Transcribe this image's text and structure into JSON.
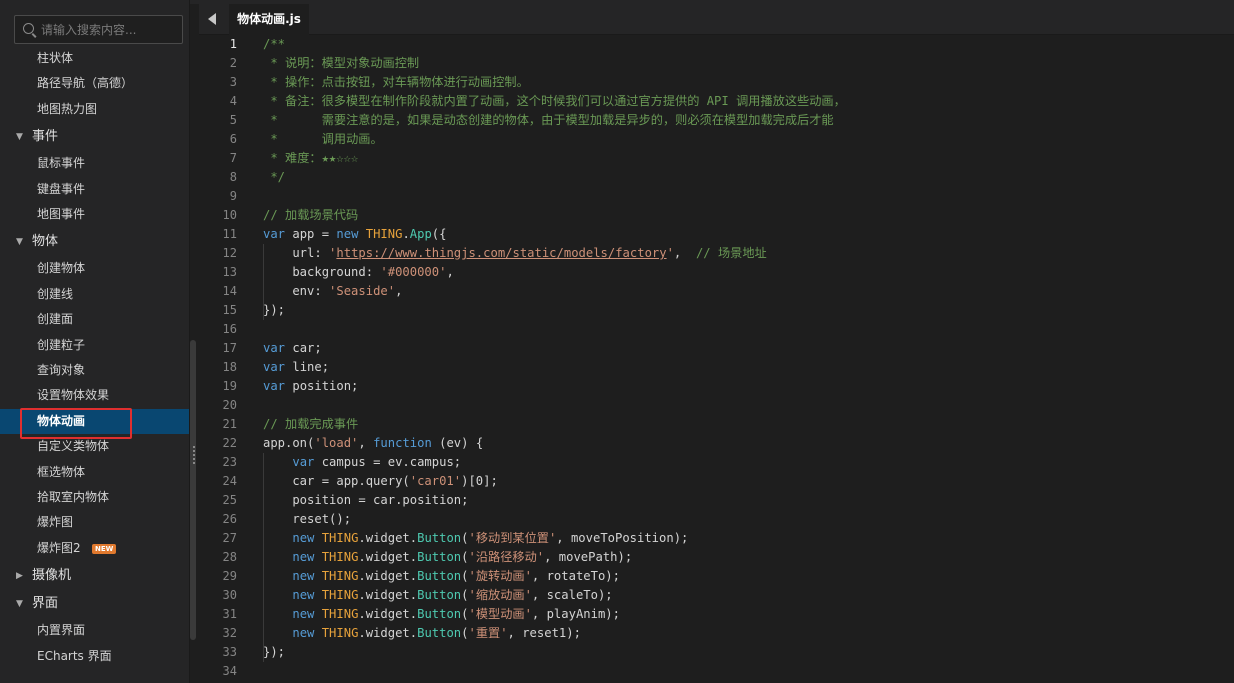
{
  "sidebar": {
    "search_placeholder": "请输入搜索内容...",
    "items_top": [
      {
        "label": "柱状体"
      },
      {
        "label": "路径导航（高德）"
      },
      {
        "label": "地图热力图"
      }
    ],
    "groups": [
      {
        "label": "事件",
        "expanded": true,
        "items": [
          "鼠标事件",
          "键盘事件",
          "地图事件"
        ]
      },
      {
        "label": "物体",
        "expanded": true,
        "items": [
          "创建物体",
          "创建线",
          "创建面",
          "创建粒子",
          "查询对象",
          "设置物体效果",
          "物体动画",
          "自定义类物体",
          "框选物体",
          "拾取室内物体",
          "爆炸图",
          "爆炸图2"
        ]
      },
      {
        "label": "摄像机",
        "expanded": false,
        "items": []
      },
      {
        "label": "界面",
        "expanded": true,
        "items": [
          "内置界面",
          "ECharts 界面"
        ]
      }
    ],
    "selected_item": "物体动画",
    "badge_text": "NEW"
  },
  "tabbar": {
    "active_tab": "物体动画.js"
  },
  "editor": {
    "active_line": 1,
    "lines": [
      [
        [
          "t-comment",
          "/**"
        ]
      ],
      [
        [
          "t-comment",
          " * 说明：模型对象动画控制"
        ]
      ],
      [
        [
          "t-comment",
          " * 操作：点击按钮，对车辆物体进行动画控制。"
        ]
      ],
      [
        [
          "t-comment",
          " * 备注：很多模型在制作阶段就内置了动画，这个时候我们可以通过官方提供的 API 调用播放这些动画，"
        ]
      ],
      [
        [
          "t-comment",
          " *      需要注意的是，如果是动态创建的物体，由于模型加载是异步的，则必须在模型加载完成后才能"
        ]
      ],
      [
        [
          "t-comment",
          " *      调用动画。"
        ]
      ],
      [
        [
          "t-comment",
          " * 难度：★★☆☆☆"
        ]
      ],
      [
        [
          "t-comment",
          " */"
        ]
      ],
      [],
      [
        [
          "t-comment",
          "// 加载场景代码"
        ]
      ],
      [
        [
          "t-kw",
          "var"
        ],
        [
          "t-plain",
          " app = "
        ],
        [
          "t-kw",
          "new"
        ],
        [
          "t-plain",
          " "
        ],
        [
          "t-cls",
          "THING"
        ],
        [
          "t-plain",
          "."
        ],
        [
          "t-fn",
          "App"
        ],
        [
          "t-plain",
          "({"
        ]
      ],
      [
        [
          "t-plain",
          "    url: "
        ],
        [
          "t-str",
          "'"
        ],
        [
          "t-str t-url",
          "https://www.thingjs.com/static/models/factory"
        ],
        [
          "t-str",
          "'"
        ],
        [
          "t-plain",
          ",  "
        ],
        [
          "t-comment",
          "// 场景地址"
        ]
      ],
      [
        [
          "t-plain",
          "    background: "
        ],
        [
          "t-str",
          "'#000000'"
        ],
        [
          "t-plain",
          ","
        ]
      ],
      [
        [
          "t-plain",
          "    env: "
        ],
        [
          "t-str",
          "'Seaside'"
        ],
        [
          "t-plain",
          ","
        ]
      ],
      [
        [
          "t-plain",
          "});"
        ]
      ],
      [],
      [
        [
          "t-kw",
          "var"
        ],
        [
          "t-plain",
          " car;"
        ]
      ],
      [
        [
          "t-kw",
          "var"
        ],
        [
          "t-plain",
          " line;"
        ]
      ],
      [
        [
          "t-kw",
          "var"
        ],
        [
          "t-plain",
          " position;"
        ]
      ],
      [],
      [
        [
          "t-comment",
          "// 加载完成事件"
        ]
      ],
      [
        [
          "t-plain",
          "app.on("
        ],
        [
          "t-str",
          "'load'"
        ],
        [
          "t-plain",
          ", "
        ],
        [
          "t-kw",
          "function"
        ],
        [
          "t-plain",
          " (ev) {"
        ]
      ],
      [
        [
          "t-plain",
          "    "
        ],
        [
          "t-kw",
          "var"
        ],
        [
          "t-plain",
          " campus = ev.campus;"
        ]
      ],
      [
        [
          "t-plain",
          "    car = app.query("
        ],
        [
          "t-str",
          "'car01'"
        ],
        [
          "t-plain",
          ")[0];"
        ]
      ],
      [
        [
          "t-plain",
          "    position = car.position;"
        ]
      ],
      [
        [
          "t-plain",
          "    reset();"
        ]
      ],
      [
        [
          "t-plain",
          "    "
        ],
        [
          "t-kw",
          "new"
        ],
        [
          "t-plain",
          " "
        ],
        [
          "t-cls",
          "THING"
        ],
        [
          "t-plain",
          ".widget."
        ],
        [
          "t-fn",
          "Button"
        ],
        [
          "t-plain",
          "("
        ],
        [
          "t-str",
          "'移动到某位置'"
        ],
        [
          "t-plain",
          ", moveToPosition);"
        ]
      ],
      [
        [
          "t-plain",
          "    "
        ],
        [
          "t-kw",
          "new"
        ],
        [
          "t-plain",
          " "
        ],
        [
          "t-cls",
          "THING"
        ],
        [
          "t-plain",
          ".widget."
        ],
        [
          "t-fn",
          "Button"
        ],
        [
          "t-plain",
          "("
        ],
        [
          "t-str",
          "'沿路径移动'"
        ],
        [
          "t-plain",
          ", movePath);"
        ]
      ],
      [
        [
          "t-plain",
          "    "
        ],
        [
          "t-kw",
          "new"
        ],
        [
          "t-plain",
          " "
        ],
        [
          "t-cls",
          "THING"
        ],
        [
          "t-plain",
          ".widget."
        ],
        [
          "t-fn",
          "Button"
        ],
        [
          "t-plain",
          "("
        ],
        [
          "t-str",
          "'旋转动画'"
        ],
        [
          "t-plain",
          ", rotateTo);"
        ]
      ],
      [
        [
          "t-plain",
          "    "
        ],
        [
          "t-kw",
          "new"
        ],
        [
          "t-plain",
          " "
        ],
        [
          "t-cls",
          "THING"
        ],
        [
          "t-plain",
          ".widget."
        ],
        [
          "t-fn",
          "Button"
        ],
        [
          "t-plain",
          "("
        ],
        [
          "t-str",
          "'缩放动画'"
        ],
        [
          "t-plain",
          ", scaleTo);"
        ]
      ],
      [
        [
          "t-plain",
          "    "
        ],
        [
          "t-kw",
          "new"
        ],
        [
          "t-plain",
          " "
        ],
        [
          "t-cls",
          "THING"
        ],
        [
          "t-plain",
          ".widget."
        ],
        [
          "t-fn",
          "Button"
        ],
        [
          "t-plain",
          "("
        ],
        [
          "t-str",
          "'模型动画'"
        ],
        [
          "t-plain",
          ", playAnim);"
        ]
      ],
      [
        [
          "t-plain",
          "    "
        ],
        [
          "t-kw",
          "new"
        ],
        [
          "t-plain",
          " "
        ],
        [
          "t-cls",
          "THING"
        ],
        [
          "t-plain",
          ".widget."
        ],
        [
          "t-fn",
          "Button"
        ],
        [
          "t-plain",
          "("
        ],
        [
          "t-str",
          "'重置'"
        ],
        [
          "t-plain",
          ", reset1);"
        ]
      ],
      [
        [
          "t-plain",
          "});"
        ]
      ],
      []
    ]
  }
}
